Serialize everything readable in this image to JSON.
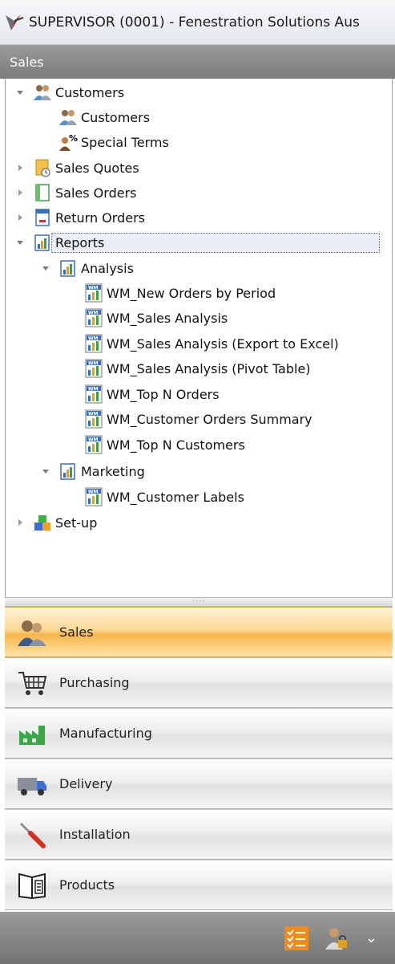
{
  "window": {
    "title": "SUPERVISOR (0001) - Fenestration Solutions Aus"
  },
  "section_header": {
    "title": "Sales"
  },
  "tree": {
    "customers": "Customers",
    "customers_child": "Customers",
    "special_terms": "Special Terms",
    "sales_quotes": "Sales Quotes",
    "sales_orders": "Sales Orders",
    "return_orders": "Return Orders",
    "reports": "Reports",
    "analysis": "Analysis",
    "analysis_items": [
      "WM_New Orders by Period",
      "WM_Sales Analysis",
      "WM_Sales Analysis (Export to Excel)",
      "WM_Sales Analysis (Pivot Table)",
      "WM_Top N Orders",
      "WM_Customer Orders Summary",
      "WM_Top N Customers"
    ],
    "marketing": "Marketing",
    "marketing_items": [
      "WM_Customer Labels"
    ],
    "setup": "Set-up"
  },
  "nav": {
    "sales": "Sales",
    "purchasing": "Purchasing",
    "manufacturing": "Manufacturing",
    "delivery": "Delivery",
    "installation": "Installation",
    "products": "Products"
  },
  "colors": {
    "active_nav": "#f8b64c",
    "header_gray": "#8a8a8a"
  }
}
